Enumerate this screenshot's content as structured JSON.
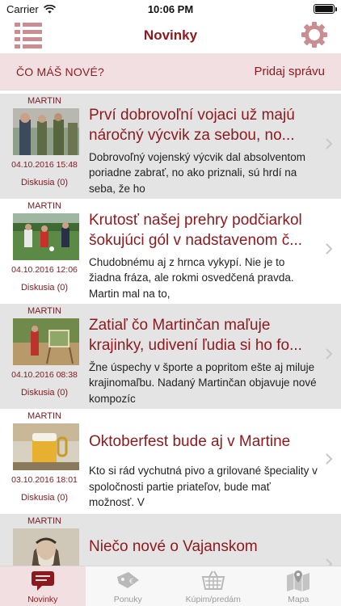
{
  "status": {
    "carrier": "Carrier",
    "time": "10:06 PM"
  },
  "nav": {
    "title": "Novinky",
    "menu_icon": "list-icon",
    "settings_icon": "gear-icon"
  },
  "whats_new": {
    "label": "ČO MÁŠ NOVÉ?",
    "action": "Pridaj správu"
  },
  "articles": [
    {
      "author": "MARTIN",
      "title": "Prví dobrovoľní vojaci už majú náročný výcvik za sebou, no...",
      "excerpt": "Dobrovoľný vojenský výcvik dal absolventom poriadne zabrať, no ako priznali, sú hrdí na seba, že ho",
      "date": "04.10.2016 15:48",
      "discussion": "Diskusia (0)"
    },
    {
      "author": "MARTIN",
      "title": "Krutosť našej prehry podčiarkol šokujúci gól v nadstavenom č...",
      "excerpt": "Chudobnému aj z hrnca vykypí. Nie je to žiadna fráza, ale rokmi osvedčená pravda. Martin mal na to,",
      "date": "04.10.2016 12:06",
      "discussion": "Diskusia (0)"
    },
    {
      "author": "MARTIN",
      "title": "Zatiaľ čo  Martinčan maľuje krajinky, udivení ľudia si ho fo...",
      "excerpt": "Žne úspechy v športe a popritom ešte aj miluje krajinomaľbu. Nadaný Martinčan objavuje nové kompozíc",
      "date": "04.10.2016 08:38",
      "discussion": "Diskusia (0)"
    },
    {
      "author": "MARTIN",
      "title": "Oktoberfest bude aj v Martine",
      "excerpt": "Kto si rád vychutná pivo a grilované špeciality v spoločnosti partie priateľov, bude mať možnosť. V",
      "date": "03.10.2016 18:01",
      "discussion": "Diskusia (0)"
    },
    {
      "author": "MARTIN",
      "title": "Niečo nové o Vajanskom",
      "excerpt": "",
      "date": "",
      "discussion": ""
    }
  ],
  "tabs": [
    {
      "label": "Novinky",
      "icon": "news-icon",
      "active": true
    },
    {
      "label": "Ponuky",
      "icon": "tag-icon",
      "active": false
    },
    {
      "label": "Kúpim/predám",
      "icon": "basket-icon",
      "active": false
    },
    {
      "label": "Mapa",
      "icon": "map-icon",
      "active": false
    }
  ],
  "colors": {
    "accent": "#8b1a1f",
    "highlight": "#f2dfe1",
    "row_gray": "#e4e4e4"
  }
}
